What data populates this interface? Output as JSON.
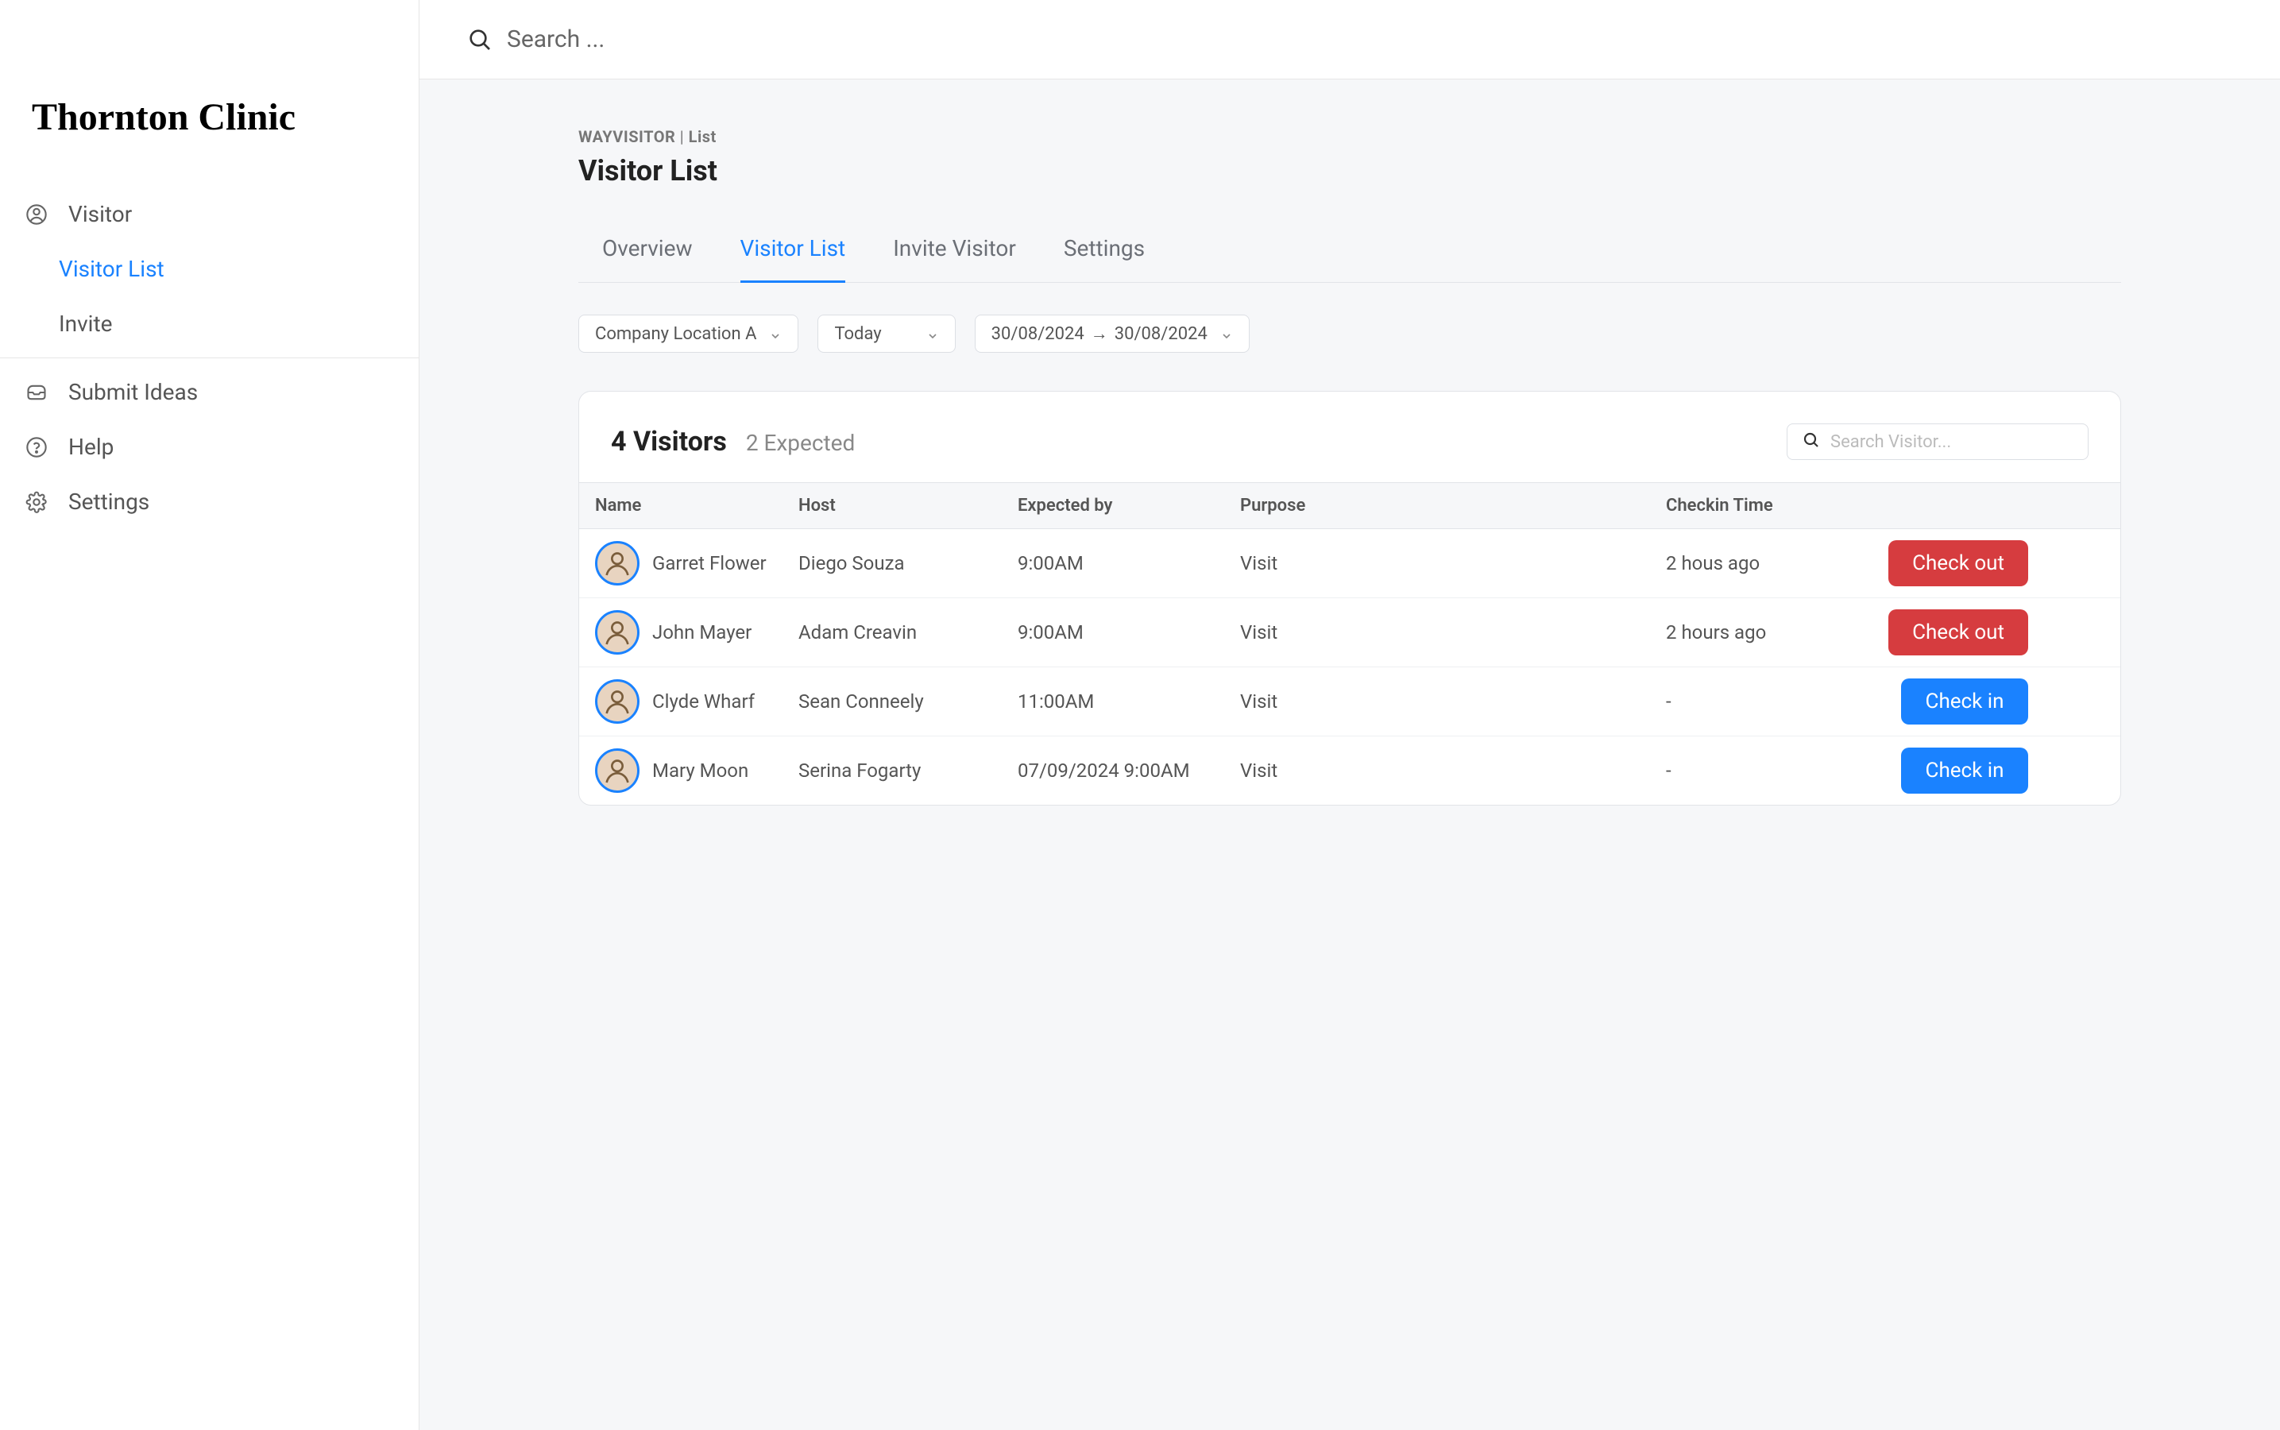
{
  "sidebar": {
    "logo": "Thornton Clinic",
    "items": [
      {
        "label": "Visitor",
        "icon": "user-circle-icon",
        "subs": [
          {
            "label": "Visitor List",
            "active": true
          },
          {
            "label": "Invite",
            "active": false
          }
        ]
      },
      {
        "label": "Submit Ideas",
        "icon": "inbox-icon"
      },
      {
        "label": "Help",
        "icon": "help-icon"
      },
      {
        "label": "Settings",
        "icon": "gear-icon"
      }
    ]
  },
  "topbar": {
    "search_placeholder": "Search ..."
  },
  "breadcrumb": {
    "app": "WAYVISITOR",
    "sep": " | ",
    "page": "List"
  },
  "page_title": "Visitor List",
  "tabs": [
    {
      "label": "Overview",
      "active": false
    },
    {
      "label": "Visitor List",
      "active": true
    },
    {
      "label": "Invite Visitor",
      "active": false
    },
    {
      "label": "Settings",
      "active": false
    }
  ],
  "filters": {
    "location": "Company Location A",
    "range_label": "Today",
    "date_from": "30/08/2024",
    "date_to": "30/08/2024",
    "date_arrow": " → "
  },
  "card": {
    "count_text": "4 Visitors",
    "expected_text": "2 Expected",
    "search_placeholder": "Search Visitor..."
  },
  "table": {
    "headers": {
      "name": "Name",
      "host": "Host",
      "expected": "Expected by",
      "purpose": "Purpose",
      "checkin": "Checkin Time"
    },
    "rows": [
      {
        "name": "Garret Flower",
        "host": "Diego Souza",
        "expected": "9:00AM",
        "purpose": "Visit",
        "checkin": "2 hous ago",
        "action_label": "Check out",
        "action_kind": "checkout"
      },
      {
        "name": "John Mayer",
        "host": "Adam Creavin",
        "expected": "9:00AM",
        "purpose": "Visit",
        "checkin": "2 hours ago",
        "action_label": "Check out",
        "action_kind": "checkout"
      },
      {
        "name": "Clyde Wharf",
        "host": "Sean Conneely",
        "expected": "11:00AM",
        "purpose": "Visit",
        "checkin": "-",
        "action_label": "Check in",
        "action_kind": "checkin"
      },
      {
        "name": "Mary Moon",
        "host": "Serina Fogarty",
        "expected": "07/09/2024 9:00AM",
        "purpose": "Visit",
        "checkin": "-",
        "action_label": "Check in",
        "action_kind": "checkin"
      }
    ]
  }
}
